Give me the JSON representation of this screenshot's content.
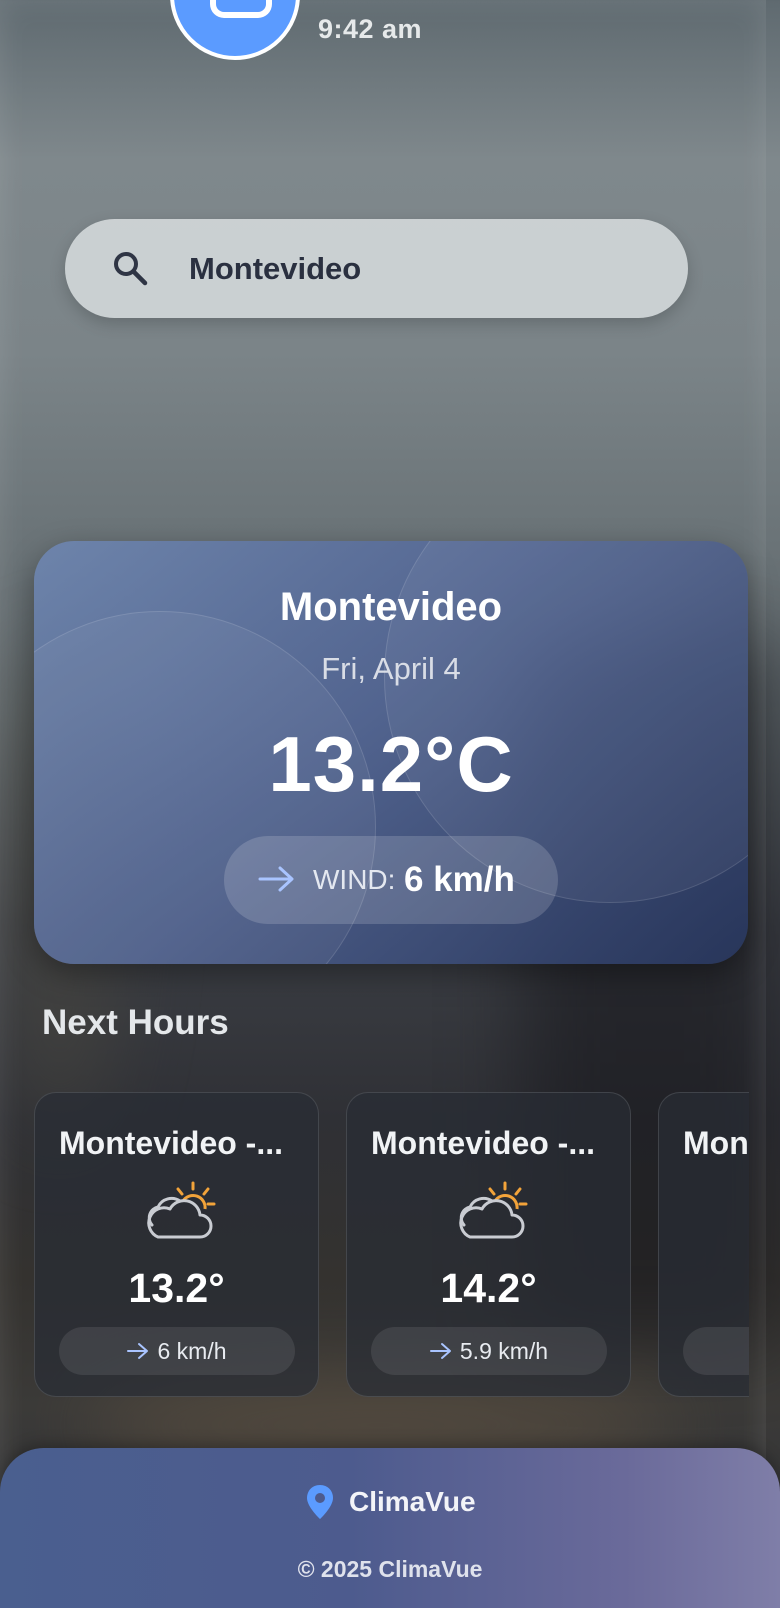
{
  "header": {
    "time": "9:42 am"
  },
  "search": {
    "value": "Montevideo",
    "placeholder": ""
  },
  "current": {
    "city": "Montevideo",
    "date": "Fri, April 4",
    "temperature": "13.2°C",
    "wind_label": "WIND:",
    "wind_value": "6 km/h"
  },
  "next_hours": {
    "title": "Next Hours",
    "items": [
      {
        "title": "Montevideo -...",
        "icon": "partly-cloudy-icon",
        "temp": "13.2°",
        "wind": "6 km/h"
      },
      {
        "title": "Montevideo -...",
        "icon": "partly-cloudy-icon",
        "temp": "14.2°",
        "wind": "5.9 km/h"
      },
      {
        "title": "Mon",
        "icon": "partly-cloudy-icon",
        "temp": "",
        "wind": ""
      }
    ]
  },
  "footer": {
    "brand": "ClimaVue",
    "copyright": "© 2025 ClimaVue"
  },
  "colors": {
    "accent": "#5b9bff",
    "sun": "#f2a33a"
  }
}
